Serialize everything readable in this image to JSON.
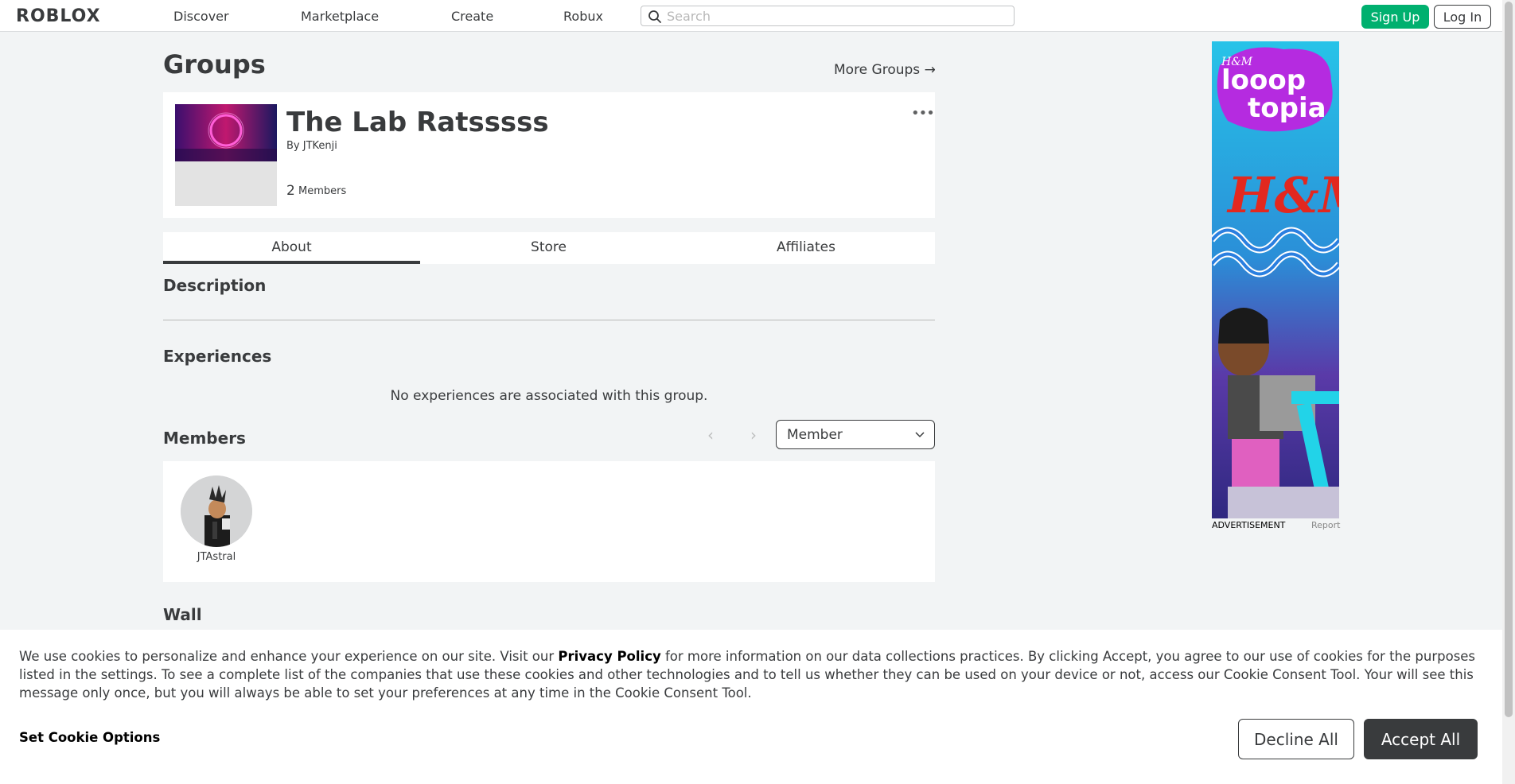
{
  "header": {
    "logo": "ROBLOX",
    "nav": [
      "Discover",
      "Marketplace",
      "Create",
      "Robux"
    ],
    "search_placeholder": "Search",
    "signup_label": "Sign Up",
    "login_label": "Log In"
  },
  "page": {
    "title": "Groups",
    "more_groups": "More Groups →"
  },
  "group": {
    "name": "The Lab Ratsssss",
    "by_label": "By",
    "owner": "JTKenji",
    "member_count": "2",
    "member_label": "Members",
    "menu_icon": "ellipsis-icon"
  },
  "tabs": [
    "About",
    "Store",
    "Affiliates"
  ],
  "sections": {
    "description": "Description",
    "experiences": "Experiences",
    "no_experiences": "No experiences are associated with this group.",
    "members": "Members",
    "wall": "Wall"
  },
  "members": {
    "role_selected": "Member",
    "list": [
      {
        "name": "JTAstral"
      }
    ]
  },
  "ad": {
    "label": "ADVERTISEMENT",
    "report": "Report",
    "brand_top": "H&M",
    "brand_word": "looop topia",
    "brand_big": "H&M"
  },
  "cookie": {
    "text_before": "We use cookies to personalize and enhance your experience on our site. Visit our ",
    "privacy_link": "Privacy Policy",
    "text_after": " for more information on our data collections practices. By clicking Accept, you agree to our use of cookies for the purposes listed in the settings. To see a complete list of the companies that use these cookies and other technologies and to tell us whether they can be used on your device or not, access our Cookie Consent Tool. Your will see this message only once, but you will always be able to set your preferences at any time in the Cookie Consent Tool.",
    "options_label": "Set Cookie Options",
    "decline_label": "Decline All",
    "accept_label": "Accept All"
  },
  "colors": {
    "signup_green": "#00b06f",
    "dark": "#393b3d",
    "page_bg": "#f2f4f5"
  }
}
